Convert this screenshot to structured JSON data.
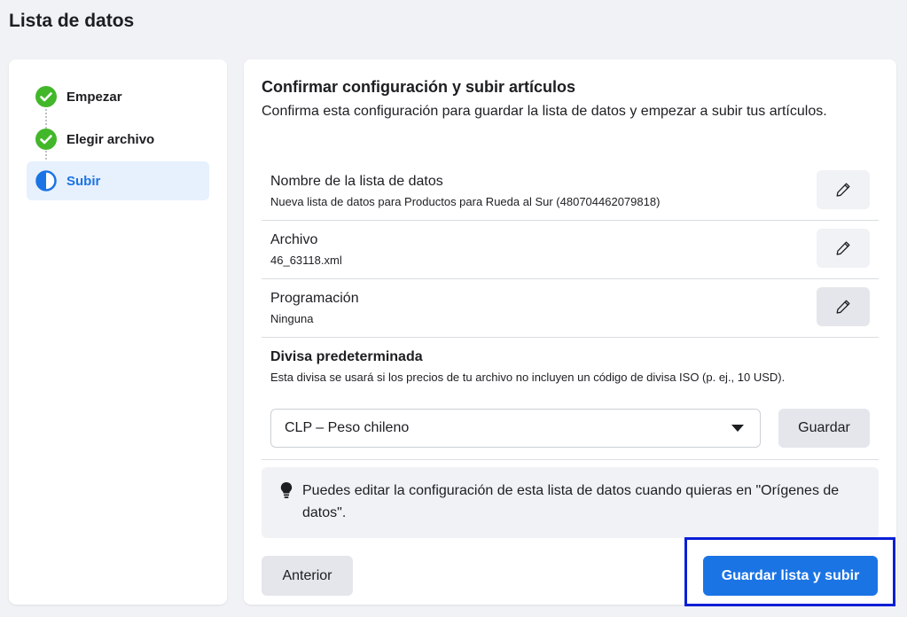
{
  "page": {
    "title": "Lista de datos"
  },
  "steps": [
    {
      "label": "Empezar",
      "state": "done"
    },
    {
      "label": "Elegir archivo",
      "state": "done"
    },
    {
      "label": "Subir",
      "state": "active"
    }
  ],
  "main": {
    "title": "Confirmar configuración y subir artículos",
    "description": "Confirma esta configuración para guardar la lista de datos y empezar a subir tus artículos.",
    "rows": [
      {
        "title": "Nombre de la lista de datos",
        "value": "Nueva lista de datos para Productos para Rueda al Sur (480704462079818)",
        "edit_icon": "pencil-icon"
      },
      {
        "title": "Archivo",
        "value": "46_63118.xml",
        "edit_icon": "pencil-icon"
      },
      {
        "title": "Programación",
        "value": "Ninguna",
        "edit_icon": "pencil-icon"
      }
    ],
    "currency": {
      "title": "Divisa predeterminada",
      "description": "Esta divisa se usará si los precios de tu archivo no incluyen un código de divisa ISO (p. ej., 10 USD).",
      "selected": "CLP – Peso chileno",
      "save_label": "Guardar"
    },
    "info": {
      "icon": "lightbulb-icon",
      "text": "Puedes editar la configuración de esta lista de datos cuando quieras en \"Orígenes de datos\"."
    },
    "previous_label": "Anterior",
    "submit_label": "Guardar lista y subir"
  },
  "colors": {
    "accent": "#1b74e4",
    "success": "#42b72a",
    "highlight": "#0a1fd6"
  }
}
